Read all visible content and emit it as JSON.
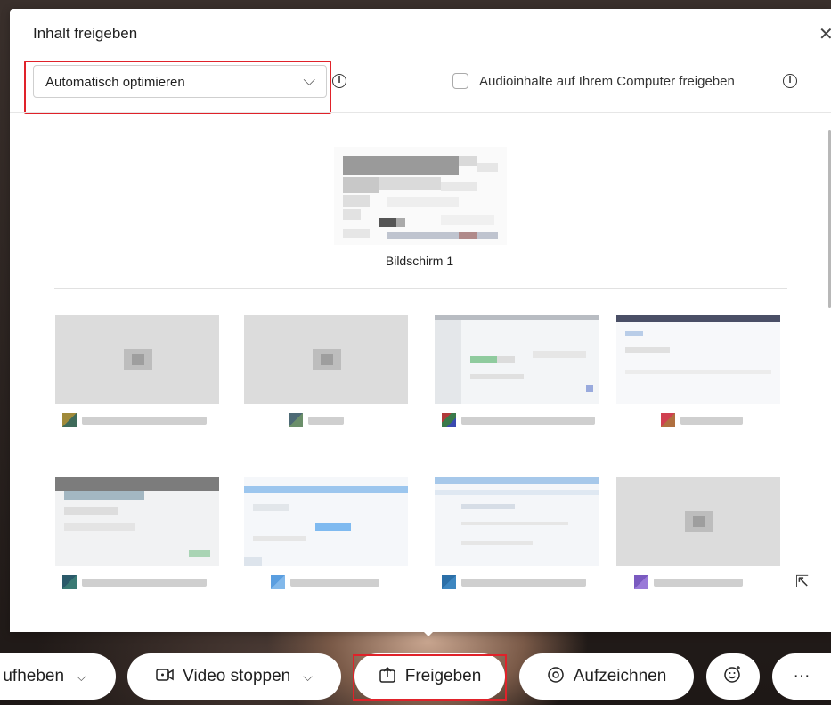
{
  "panel": {
    "title": "Inhalt freigeben",
    "close_icon": "close-icon",
    "optimize": {
      "selected": "Automatisch optimieren",
      "icon": "chevron-down-icon"
    },
    "audio": {
      "label": "Audioinhalte auf Ihrem Computer freigeben",
      "checked": false
    },
    "info_icon": "i"
  },
  "screens": [
    {
      "label": "Bildschirm 1"
    }
  ],
  "toolbar": {
    "mute_label": "ufheben",
    "video_label": "Video stoppen",
    "share_label": "Freigeben",
    "record_label": "Aufzeichnen",
    "reactions_icon": "emoji-icon",
    "more_label": "···"
  },
  "colors": {
    "highlight": "#e0222a",
    "panel_bg": "#ffffff"
  }
}
